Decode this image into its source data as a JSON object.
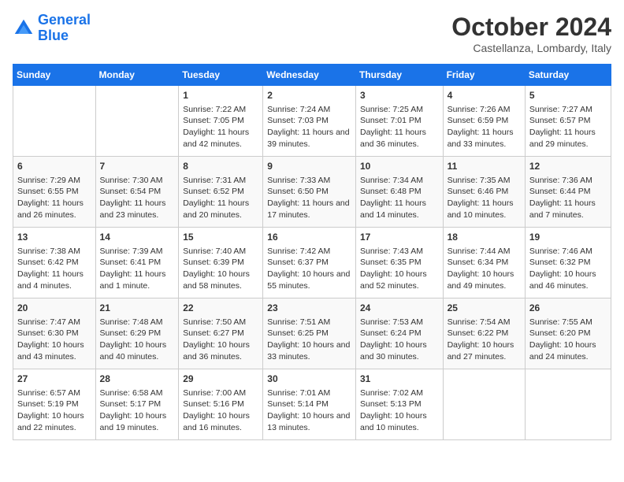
{
  "logo": {
    "text_general": "General",
    "text_blue": "Blue"
  },
  "header": {
    "month": "October 2024",
    "location": "Castellanza, Lombardy, Italy"
  },
  "weekdays": [
    "Sunday",
    "Monday",
    "Tuesday",
    "Wednesday",
    "Thursday",
    "Friday",
    "Saturday"
  ],
  "weeks": [
    [
      {
        "day": "",
        "content": ""
      },
      {
        "day": "",
        "content": ""
      },
      {
        "day": "1",
        "content": "Sunrise: 7:22 AM\nSunset: 7:05 PM\nDaylight: 11 hours and 42 minutes."
      },
      {
        "day": "2",
        "content": "Sunrise: 7:24 AM\nSunset: 7:03 PM\nDaylight: 11 hours and 39 minutes."
      },
      {
        "day": "3",
        "content": "Sunrise: 7:25 AM\nSunset: 7:01 PM\nDaylight: 11 hours and 36 minutes."
      },
      {
        "day": "4",
        "content": "Sunrise: 7:26 AM\nSunset: 6:59 PM\nDaylight: 11 hours and 33 minutes."
      },
      {
        "day": "5",
        "content": "Sunrise: 7:27 AM\nSunset: 6:57 PM\nDaylight: 11 hours and 29 minutes."
      }
    ],
    [
      {
        "day": "6",
        "content": "Sunrise: 7:29 AM\nSunset: 6:55 PM\nDaylight: 11 hours and 26 minutes."
      },
      {
        "day": "7",
        "content": "Sunrise: 7:30 AM\nSunset: 6:54 PM\nDaylight: 11 hours and 23 minutes."
      },
      {
        "day": "8",
        "content": "Sunrise: 7:31 AM\nSunset: 6:52 PM\nDaylight: 11 hours and 20 minutes."
      },
      {
        "day": "9",
        "content": "Sunrise: 7:33 AM\nSunset: 6:50 PM\nDaylight: 11 hours and 17 minutes."
      },
      {
        "day": "10",
        "content": "Sunrise: 7:34 AM\nSunset: 6:48 PM\nDaylight: 11 hours and 14 minutes."
      },
      {
        "day": "11",
        "content": "Sunrise: 7:35 AM\nSunset: 6:46 PM\nDaylight: 11 hours and 10 minutes."
      },
      {
        "day": "12",
        "content": "Sunrise: 7:36 AM\nSunset: 6:44 PM\nDaylight: 11 hours and 7 minutes."
      }
    ],
    [
      {
        "day": "13",
        "content": "Sunrise: 7:38 AM\nSunset: 6:42 PM\nDaylight: 11 hours and 4 minutes."
      },
      {
        "day": "14",
        "content": "Sunrise: 7:39 AM\nSunset: 6:41 PM\nDaylight: 11 hours and 1 minute."
      },
      {
        "day": "15",
        "content": "Sunrise: 7:40 AM\nSunset: 6:39 PM\nDaylight: 10 hours and 58 minutes."
      },
      {
        "day": "16",
        "content": "Sunrise: 7:42 AM\nSunset: 6:37 PM\nDaylight: 10 hours and 55 minutes."
      },
      {
        "day": "17",
        "content": "Sunrise: 7:43 AM\nSunset: 6:35 PM\nDaylight: 10 hours and 52 minutes."
      },
      {
        "day": "18",
        "content": "Sunrise: 7:44 AM\nSunset: 6:34 PM\nDaylight: 10 hours and 49 minutes."
      },
      {
        "day": "19",
        "content": "Sunrise: 7:46 AM\nSunset: 6:32 PM\nDaylight: 10 hours and 46 minutes."
      }
    ],
    [
      {
        "day": "20",
        "content": "Sunrise: 7:47 AM\nSunset: 6:30 PM\nDaylight: 10 hours and 43 minutes."
      },
      {
        "day": "21",
        "content": "Sunrise: 7:48 AM\nSunset: 6:29 PM\nDaylight: 10 hours and 40 minutes."
      },
      {
        "day": "22",
        "content": "Sunrise: 7:50 AM\nSunset: 6:27 PM\nDaylight: 10 hours and 36 minutes."
      },
      {
        "day": "23",
        "content": "Sunrise: 7:51 AM\nSunset: 6:25 PM\nDaylight: 10 hours and 33 minutes."
      },
      {
        "day": "24",
        "content": "Sunrise: 7:53 AM\nSunset: 6:24 PM\nDaylight: 10 hours and 30 minutes."
      },
      {
        "day": "25",
        "content": "Sunrise: 7:54 AM\nSunset: 6:22 PM\nDaylight: 10 hours and 27 minutes."
      },
      {
        "day": "26",
        "content": "Sunrise: 7:55 AM\nSunset: 6:20 PM\nDaylight: 10 hours and 24 minutes."
      }
    ],
    [
      {
        "day": "27",
        "content": "Sunrise: 6:57 AM\nSunset: 5:19 PM\nDaylight: 10 hours and 22 minutes."
      },
      {
        "day": "28",
        "content": "Sunrise: 6:58 AM\nSunset: 5:17 PM\nDaylight: 10 hours and 19 minutes."
      },
      {
        "day": "29",
        "content": "Sunrise: 7:00 AM\nSunset: 5:16 PM\nDaylight: 10 hours and 16 minutes."
      },
      {
        "day": "30",
        "content": "Sunrise: 7:01 AM\nSunset: 5:14 PM\nDaylight: 10 hours and 13 minutes."
      },
      {
        "day": "31",
        "content": "Sunrise: 7:02 AM\nSunset: 5:13 PM\nDaylight: 10 hours and 10 minutes."
      },
      {
        "day": "",
        "content": ""
      },
      {
        "day": "",
        "content": ""
      }
    ]
  ]
}
